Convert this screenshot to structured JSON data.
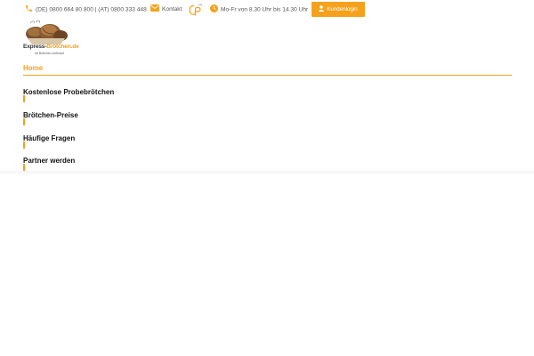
{
  "topbar": {
    "phone": "(DE) 0800 664 80 800 | (AT) 0800 333 448",
    "contact": "Kontakt",
    "hours": "Mo-Fr von 8.30 Uhr bis 14.30 Uhr",
    "login": "Kundenlogin"
  },
  "logo": {
    "brand_first": "Express-",
    "brand_second": "Brötchen.de",
    "tagline": "Ihr Brötchen-Lieferant"
  },
  "nav": {
    "home": "Home",
    "items": [
      "Kostenlose Probebrötchen",
      "Brötchen-Preise",
      "Häufige Fragen",
      "Partner werden"
    ]
  },
  "colors": {
    "accent": "#f5a11c",
    "text": "#333333"
  },
  "icons": {
    "phone": "phone-icon",
    "mail": "mail-icon",
    "logo_small": "cp-logo-icon",
    "clock": "clock-icon",
    "user": "user-icon"
  }
}
